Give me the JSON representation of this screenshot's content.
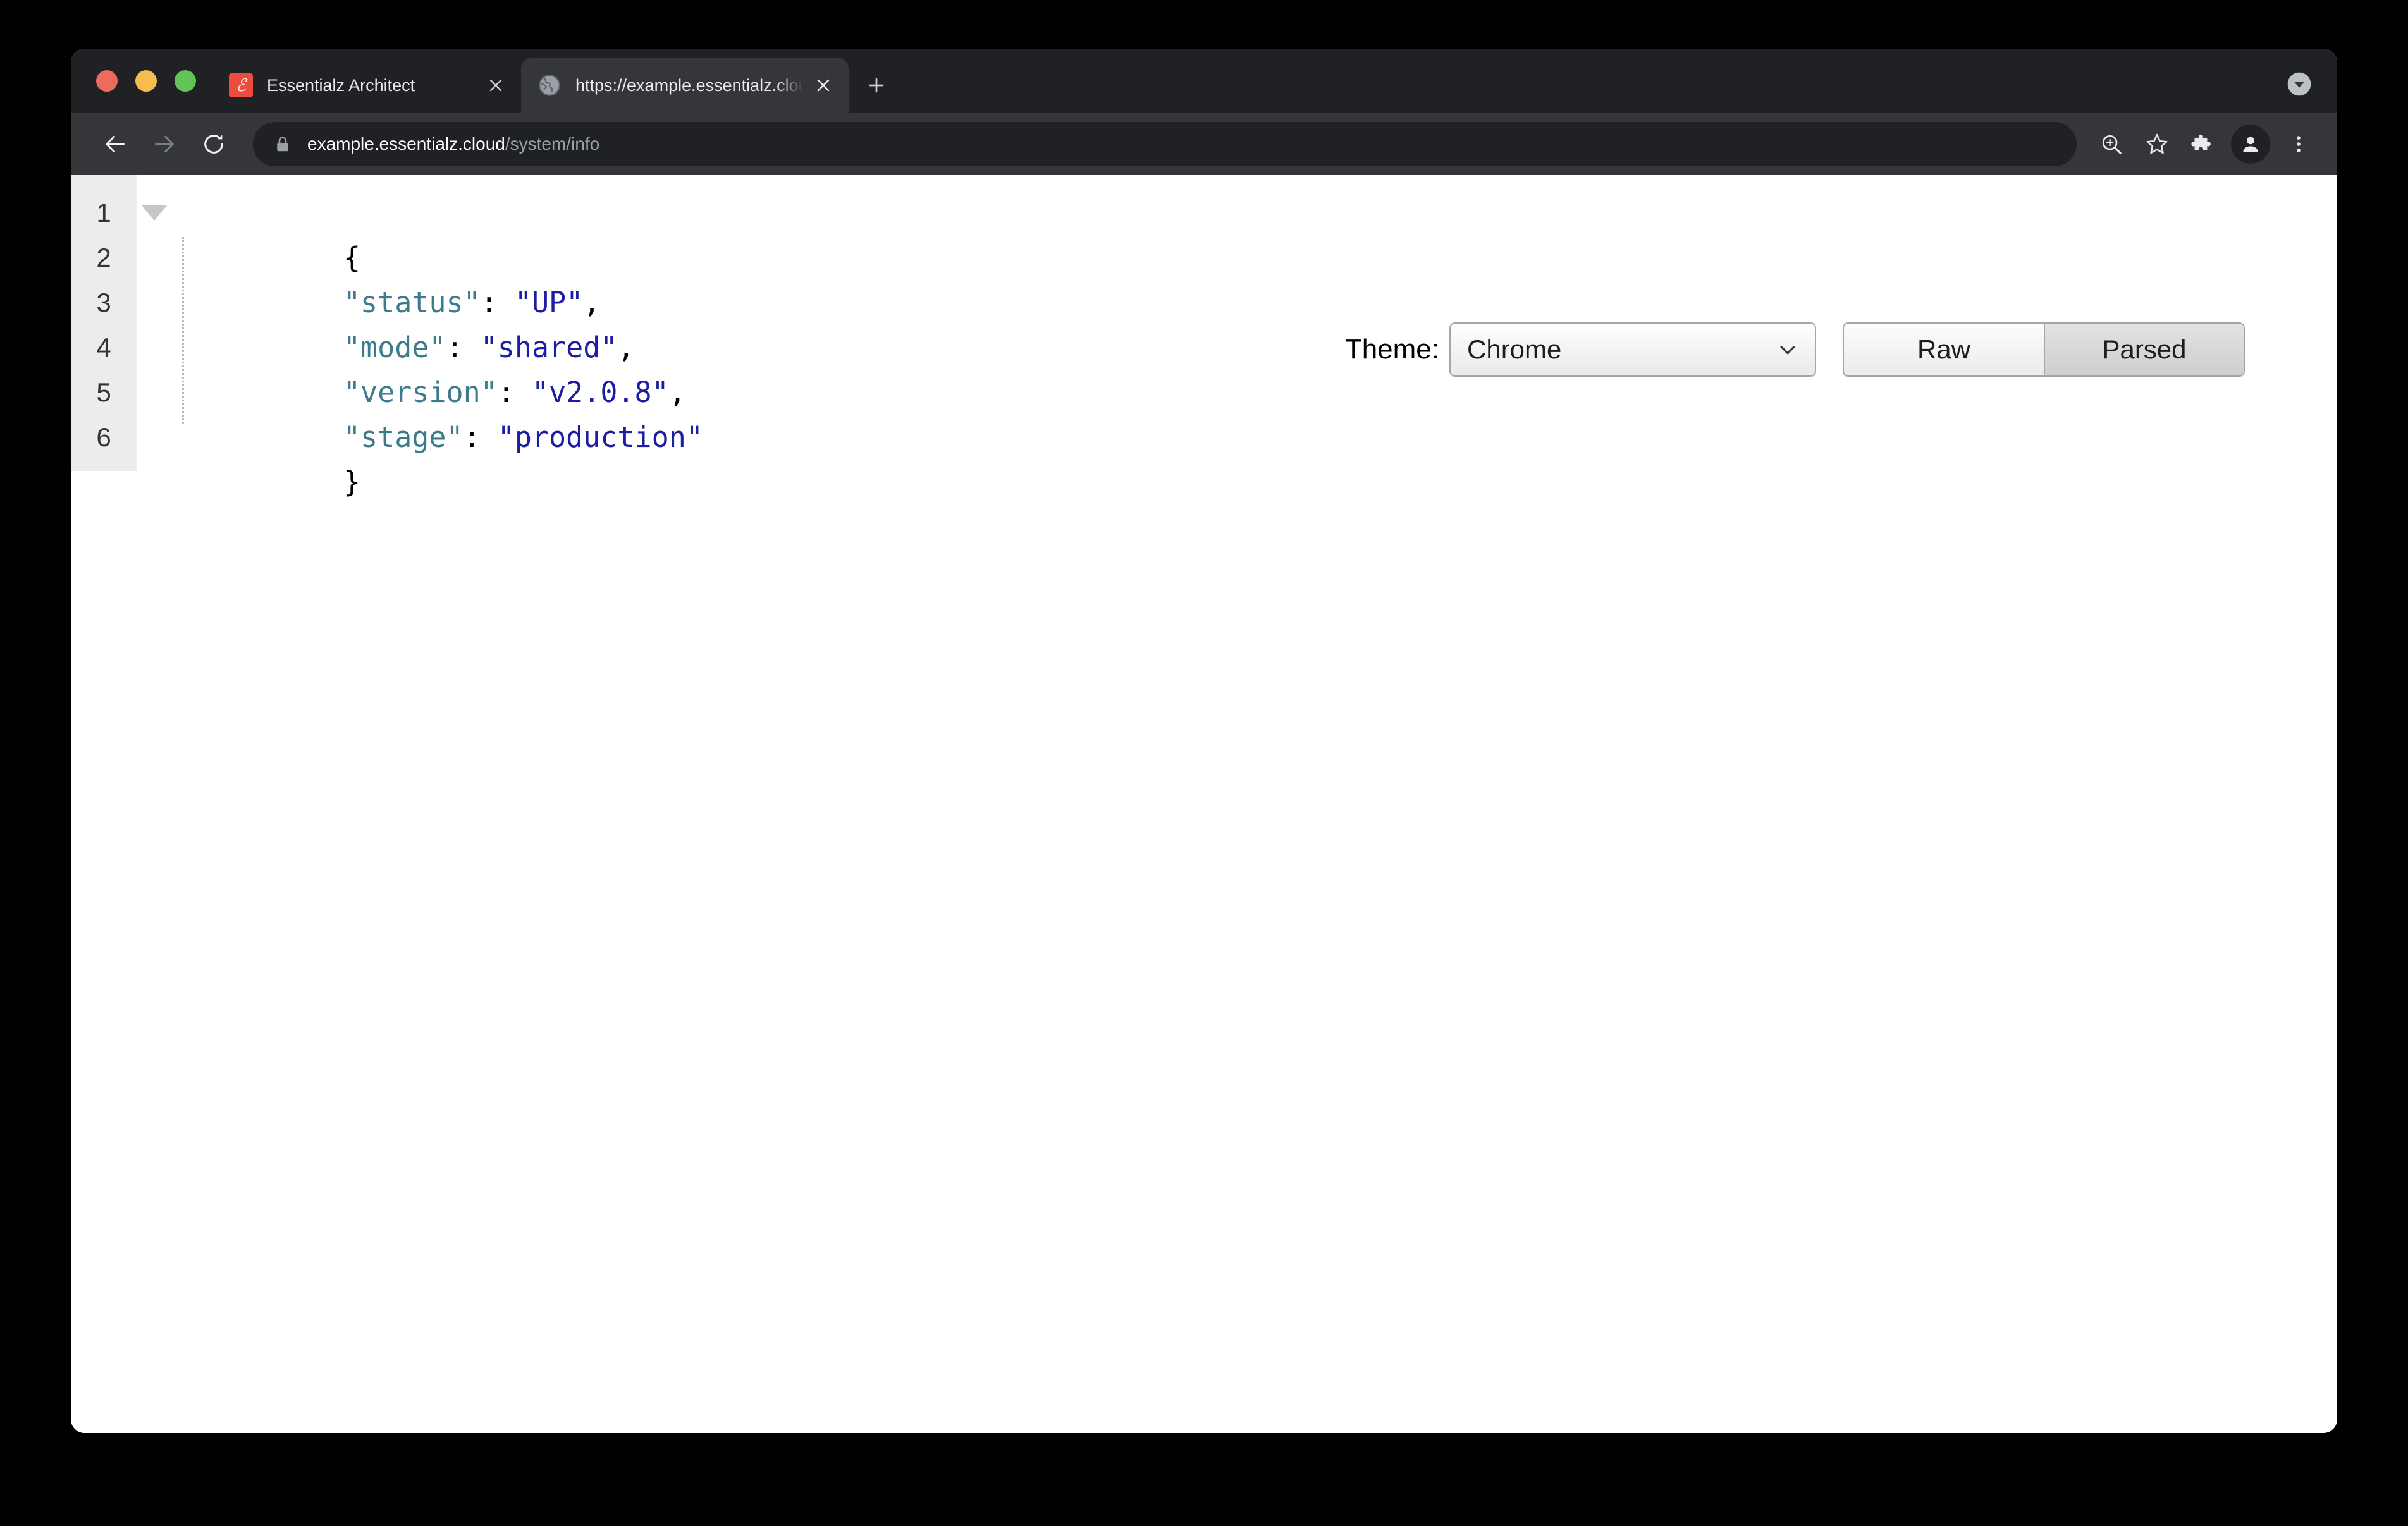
{
  "window": {
    "traffic_lights": [
      {
        "name": "close",
        "color": "#ed6a5e"
      },
      {
        "name": "minimize",
        "color": "#f5bd4f"
      },
      {
        "name": "maximize",
        "color": "#61c454"
      }
    ]
  },
  "tabs": [
    {
      "title": "Essentialz Architect",
      "favicon": "architect-logo-icon",
      "active": false,
      "close_label": "×"
    },
    {
      "title": "https://example.essentialz.clou",
      "favicon": "globe-icon",
      "active": true,
      "close_label": "×"
    }
  ],
  "tab_strip": {
    "new_tab_label": "+",
    "new_tab_icon": "plus-icon",
    "tab_search_icon": "chevron-down-circle-icon"
  },
  "toolbar": {
    "back_icon": "arrow-left-icon",
    "forward_icon": "arrow-right-icon",
    "reload_icon": "reload-icon",
    "lock_icon": "lock-icon",
    "url_domain": "example.essentialz.cloud",
    "url_path": "/system/info",
    "zoom_icon": "zoom-in-icon",
    "bookmark_icon": "star-icon",
    "extensions_icon": "puzzle-piece-icon",
    "profile_icon": "person-icon",
    "menu_icon": "three-dots-vertical-icon"
  },
  "json_viewer": {
    "theme_label": "Theme:",
    "theme_value": "Chrome",
    "theme_chevron_icon": "chevron-down-icon",
    "view_modes": [
      {
        "label": "Raw",
        "active": false
      },
      {
        "label": "Parsed",
        "active": true
      }
    ],
    "collapse_icon": "triangle-down-icon",
    "line_numbers": [
      "1",
      "2",
      "3",
      "4",
      "5",
      "6"
    ],
    "lines": [
      {
        "indent": 0,
        "tokens": [
          {
            "t": "punct",
            "v": "{"
          }
        ]
      },
      {
        "indent": 1,
        "tokens": [
          {
            "t": "key",
            "v": "\"status\""
          },
          {
            "t": "punct",
            "v": ": "
          },
          {
            "t": "string",
            "v": "\"UP\""
          },
          {
            "t": "punct",
            "v": ","
          }
        ]
      },
      {
        "indent": 1,
        "tokens": [
          {
            "t": "key",
            "v": "\"mode\""
          },
          {
            "t": "punct",
            "v": ": "
          },
          {
            "t": "string",
            "v": "\"shared\""
          },
          {
            "t": "punct",
            "v": ","
          }
        ]
      },
      {
        "indent": 1,
        "tokens": [
          {
            "t": "key",
            "v": "\"version\""
          },
          {
            "t": "punct",
            "v": ": "
          },
          {
            "t": "string",
            "v": "\"v2.0.8\""
          },
          {
            "t": "punct",
            "v": ","
          }
        ]
      },
      {
        "indent": 1,
        "tokens": [
          {
            "t": "key",
            "v": "\"stage\""
          },
          {
            "t": "punct",
            "v": ": "
          },
          {
            "t": "string",
            "v": "\"production\""
          }
        ]
      },
      {
        "indent": 0,
        "tokens": [
          {
            "t": "punct",
            "v": "}"
          }
        ]
      }
    ],
    "payload": {
      "status": "UP",
      "mode": "shared",
      "version": "v2.0.8",
      "stage": "production"
    },
    "colors": {
      "key": "#3d7b8c",
      "string": "#1d1da4",
      "punctuation": "#000000",
      "gutter_bg": "#ececec",
      "gutter_text": "#333333"
    }
  }
}
